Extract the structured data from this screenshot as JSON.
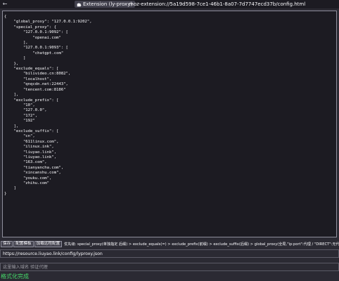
{
  "browser": {
    "identity_label": "Extension (ly-proxy)",
    "url": "moz-extension://5a19d598-7ce1-46b1-8a07-7d7747ecd37b/config.html"
  },
  "editor": {
    "content": "{\n    \"global_proxy\": \"127.0.0.1:9202\",\n    \"special_proxy\": {\n        \"127.0.0.1:9092\": [\n            \"openai.com\"\n        ],\n        \"127.0.0.1:9093\": [\n            \"chatgpt.com\"\n        ]\n    },\n    \"exclude_equals\": [\n        \"bilivideo.cn:8082\",\n        \"localhost\",\n        \"qnqcdn.net:22443\",\n        \"tencent.com:8186\"\n    ],\n    \"exclude_prefix\": [\n        \"10\",\n        \"127.0.0\",\n        \"172\",\n        \"192\"\n    ],\n    \"exclude_suffix\": [\n        \"cn\",\n        \"611linux.com\",\n        \"ilinux.ink\",\n        \"liuyao.link\",\n        \"liuyao.link\",\n        \"163.com\",\n        \"tianyancha.com\",\n        \"xincanshu.com\",\n        \"youku.com\",\n        \"zhihu.com\"\n    ]\n}"
  },
  "toolbar": {
    "save_label": "保存",
    "template_label": "配置模板",
    "load_remote_label": "加载远程配置",
    "priority_text": "优先级: special_proxy(单独指定 后缀) > exclude_equals(=) > exclude_prefix(前缀) > exclude_suffix(后缀) > global_proxy(全局,\"ip:port\":代理 / \"DIRECT\":无代理)"
  },
  "remote_url": {
    "value": "https://resource.liuyao.link/config/lyproxy.json"
  },
  "domain_input": {
    "placeholder": "这里输入域名 验证代理"
  },
  "status": {
    "message": "格式化完成",
    "color": "#45d96a"
  },
  "colors": {
    "background": "#2b2a33",
    "editor_background": "#1c1b22",
    "text": "#fbfbfe",
    "success": "#45d96a"
  },
  "icons": {
    "back": "arrow-left-icon",
    "identity": "puzzle-piece-icon"
  }
}
